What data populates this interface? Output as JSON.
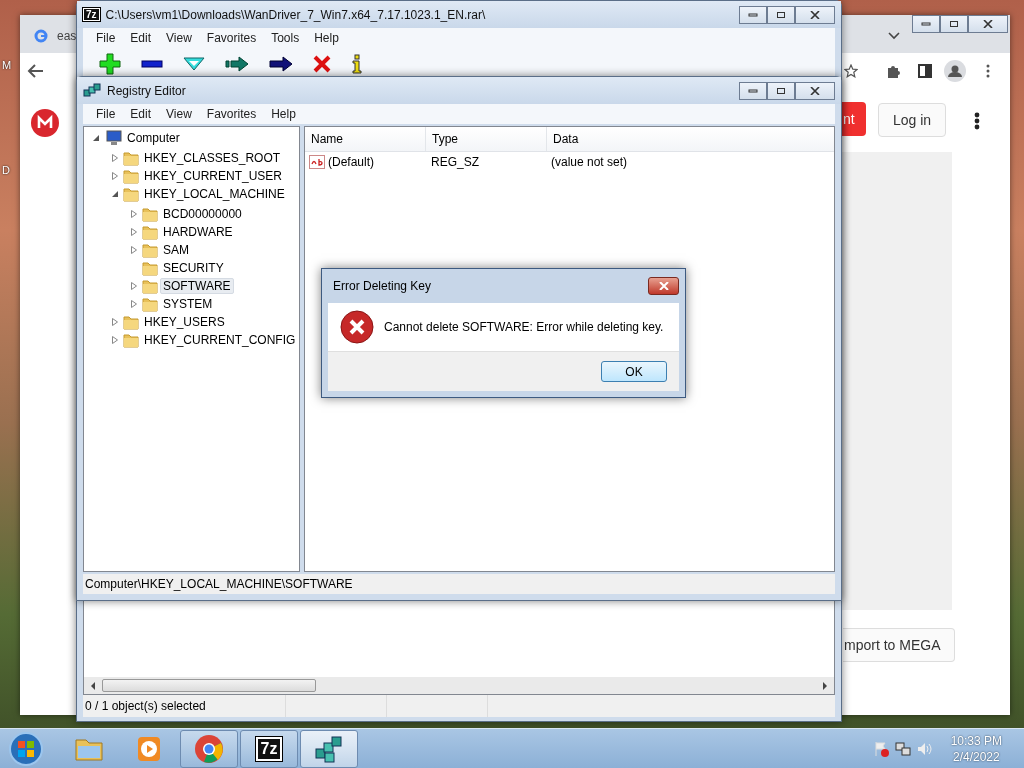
{
  "desktop": {
    "icon_labels": [
      "M",
      "D"
    ]
  },
  "browser": {
    "tab_title": "eas",
    "primary_button": "nt",
    "login_button": "Log in",
    "import_button": "mport to MEGA"
  },
  "sevenzip": {
    "logo": "7z",
    "title": "C:\\Users\\vm1\\Downloads\\WanDriver_7_Win7.x64_7.17.1023.1_EN.rar\\",
    "menu": [
      "File",
      "Edit",
      "View",
      "Favorites",
      "Tools",
      "Help"
    ],
    "status_bar": "0 / 1 object(s) selected"
  },
  "regedit": {
    "title": "Registry Editor",
    "menu": [
      "File",
      "Edit",
      "View",
      "Favorites",
      "Help"
    ],
    "tree": [
      {
        "label": "Computer",
        "kind": "computer",
        "expanded": true,
        "selected": false,
        "children": [
          {
            "label": "HKEY_CLASSES_ROOT",
            "kind": "folder",
            "expanded": false,
            "selected": false
          },
          {
            "label": "HKEY_CURRENT_USER",
            "kind": "folder",
            "expanded": false,
            "selected": false
          },
          {
            "label": "HKEY_LOCAL_MACHINE",
            "kind": "folder",
            "expanded": true,
            "selected": false,
            "children": [
              {
                "label": "BCD00000000",
                "kind": "folder",
                "expanded": false,
                "selected": false
              },
              {
                "label": "HARDWARE",
                "kind": "folder",
                "expanded": false,
                "selected": false
              },
              {
                "label": "SAM",
                "kind": "folder",
                "expanded": false,
                "selected": false
              },
              {
                "label": "SECURITY",
                "kind": "leaf",
                "selected": false
              },
              {
                "label": "SOFTWARE",
                "kind": "folder",
                "expanded": false,
                "selected": true
              },
              {
                "label": "SYSTEM",
                "kind": "folder",
                "expanded": false,
                "selected": false
              }
            ]
          },
          {
            "label": "HKEY_USERS",
            "kind": "folder",
            "expanded": false,
            "selected": false
          },
          {
            "label": "HKEY_CURRENT_CONFIG",
            "kind": "folder",
            "expanded": false,
            "selected": false
          }
        ]
      }
    ],
    "columns": [
      "Name",
      "Type",
      "Data"
    ],
    "rows": [
      {
        "name": "(Default)",
        "type": "REG_SZ",
        "data": "(value not set)"
      }
    ],
    "status_bar": "Computer\\HKEY_LOCAL_MACHINE\\SOFTWARE"
  },
  "dialog": {
    "title": "Error Deleting Key",
    "message": "Cannot delete SOFTWARE:  Error while deleting key.",
    "button": "OK"
  },
  "taskbar": {
    "apps": [
      {
        "kind": "explorer",
        "running": false,
        "selected": false
      },
      {
        "kind": "media",
        "running": false,
        "selected": false
      },
      {
        "kind": "chrome",
        "running": true,
        "selected": false
      },
      {
        "kind": "archiver",
        "running": true,
        "selected": false,
        "logo": "7z"
      },
      {
        "kind": "registry",
        "running": true,
        "selected": true
      }
    ],
    "clock_time": "10:33 PM",
    "clock_date": "2/4/2022"
  }
}
